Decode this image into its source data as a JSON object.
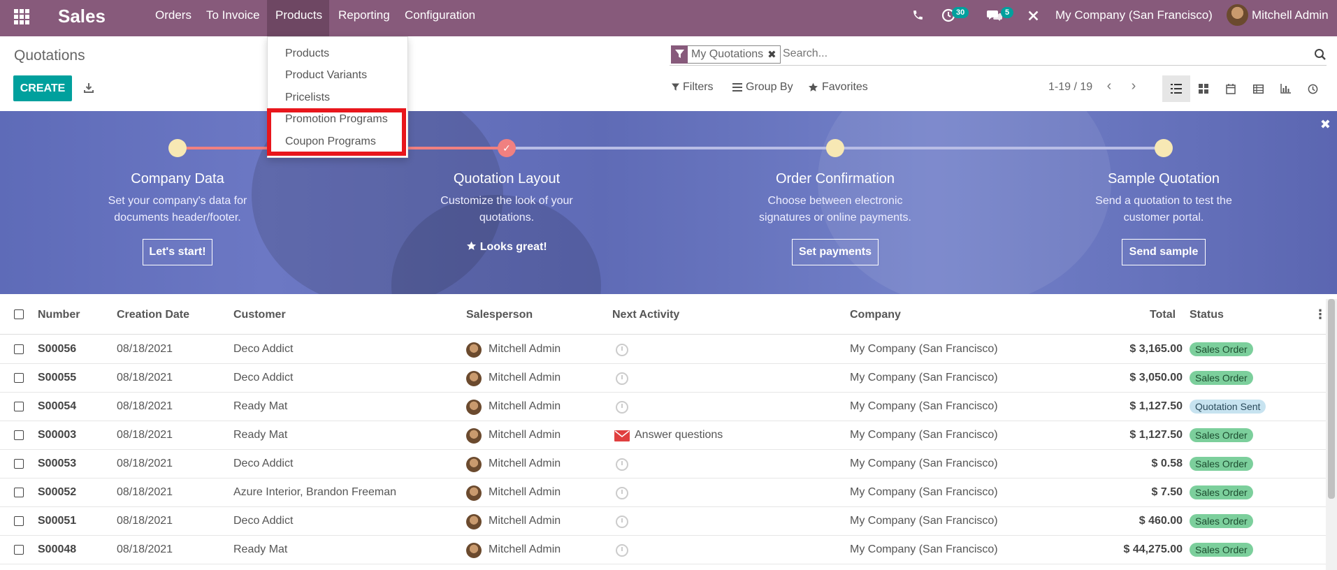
{
  "nav": {
    "brand": "Sales",
    "menu": [
      "Orders",
      "To Invoice",
      "Products",
      "Reporting",
      "Configuration"
    ],
    "activity_count": "30",
    "messages_count": "5",
    "company": "My Company (San Francisco)",
    "user": "Mitchell Admin"
  },
  "products_menu": {
    "items": [
      "Products",
      "Product Variants",
      "Pricelists",
      "Promotion Programs",
      "Coupon Programs"
    ]
  },
  "control": {
    "breadcrumb": "Quotations",
    "create_label": "CREATE",
    "facet": "My Quotations",
    "search_placeholder": "Search...",
    "filters": "Filters",
    "group_by": "Group By",
    "favorites": "Favorites",
    "pager": "1-19 / 19"
  },
  "banner": {
    "steps": [
      {
        "title": "Company Data",
        "desc": "Set your company's data for documents header/footer.",
        "action": "Let's start!"
      },
      {
        "title": "Quotation Layout",
        "desc": "Customize the look of your quotations.",
        "action": "Looks great!"
      },
      {
        "title": "Order Confirmation",
        "desc": "Choose between electronic signatures or online payments.",
        "action": "Set payments"
      },
      {
        "title": "Sample Quotation",
        "desc": "Send a quotation to test the customer portal.",
        "action": "Send sample"
      }
    ]
  },
  "table": {
    "headers": [
      "Number",
      "Creation Date",
      "Customer",
      "Salesperson",
      "Next Activity",
      "Company",
      "Total",
      "Status"
    ],
    "rows": [
      {
        "number": "S00056",
        "date": "08/18/2021",
        "customer": "Deco Addict",
        "salesperson": "Mitchell Admin",
        "activity": "",
        "company": "My Company (San Francisco)",
        "total": "$ 3,165.00",
        "status": "Sales Order"
      },
      {
        "number": "S00055",
        "date": "08/18/2021",
        "customer": "Deco Addict",
        "salesperson": "Mitchell Admin",
        "activity": "",
        "company": "My Company (San Francisco)",
        "total": "$ 3,050.00",
        "status": "Sales Order"
      },
      {
        "number": "S00054",
        "date": "08/18/2021",
        "customer": "Ready Mat",
        "salesperson": "Mitchell Admin",
        "activity": "",
        "company": "My Company (San Francisco)",
        "total": "$ 1,127.50",
        "status": "Quotation Sent"
      },
      {
        "number": "S00003",
        "date": "08/18/2021",
        "customer": "Ready Mat",
        "salesperson": "Mitchell Admin",
        "activity": "Answer questions",
        "company": "My Company (San Francisco)",
        "total": "$ 1,127.50",
        "status": "Sales Order"
      },
      {
        "number": "S00053",
        "date": "08/18/2021",
        "customer": "Deco Addict",
        "salesperson": "Mitchell Admin",
        "activity": "",
        "company": "My Company (San Francisco)",
        "total": "$ 0.58",
        "status": "Sales Order"
      },
      {
        "number": "S00052",
        "date": "08/18/2021",
        "customer": "Azure Interior, Brandon Freeman",
        "salesperson": "Mitchell Admin",
        "activity": "",
        "company": "My Company (San Francisco)",
        "total": "$ 7.50",
        "status": "Sales Order"
      },
      {
        "number": "S00051",
        "date": "08/18/2021",
        "customer": "Deco Addict",
        "salesperson": "Mitchell Admin",
        "activity": "",
        "company": "My Company (San Francisco)",
        "total": "$ 460.00",
        "status": "Sales Order"
      },
      {
        "number": "S00048",
        "date": "08/18/2021",
        "customer": "Ready Mat",
        "salesperson": "Mitchell Admin",
        "activity": "",
        "company": "My Company (San Francisco)",
        "total": "$ 44,275.00",
        "status": "Sales Order"
      }
    ]
  }
}
